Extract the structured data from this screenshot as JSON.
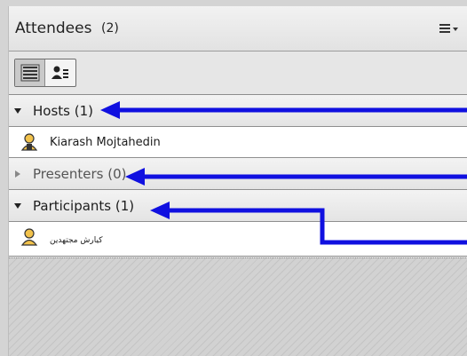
{
  "panel": {
    "title": "Attendees",
    "count": "(2)",
    "menu_icon": "list-menu-icon"
  },
  "toolbar": {
    "views": [
      {
        "name": "list-view",
        "icon": "list-view-icon",
        "active": true
      },
      {
        "name": "role-view",
        "icon": "person-list-icon",
        "active": false
      }
    ]
  },
  "sections": {
    "hosts": {
      "label": "Hosts (1)",
      "expanded": true
    },
    "presenters": {
      "label": "Presenters (0)",
      "expanded": false
    },
    "participants": {
      "label": "Participants (1)",
      "expanded": true
    }
  },
  "attendees": {
    "host": {
      "name": "Kiarash Mojtahedin",
      "icon": "host-user-icon"
    },
    "participant": {
      "name": "کیارش مجتهدین",
      "icon": "participant-user-icon"
    }
  },
  "colors": {
    "annotation_arrow": "#1010e0",
    "panel_bg": "#e9e9e9",
    "row_bg": "#ffffff"
  }
}
